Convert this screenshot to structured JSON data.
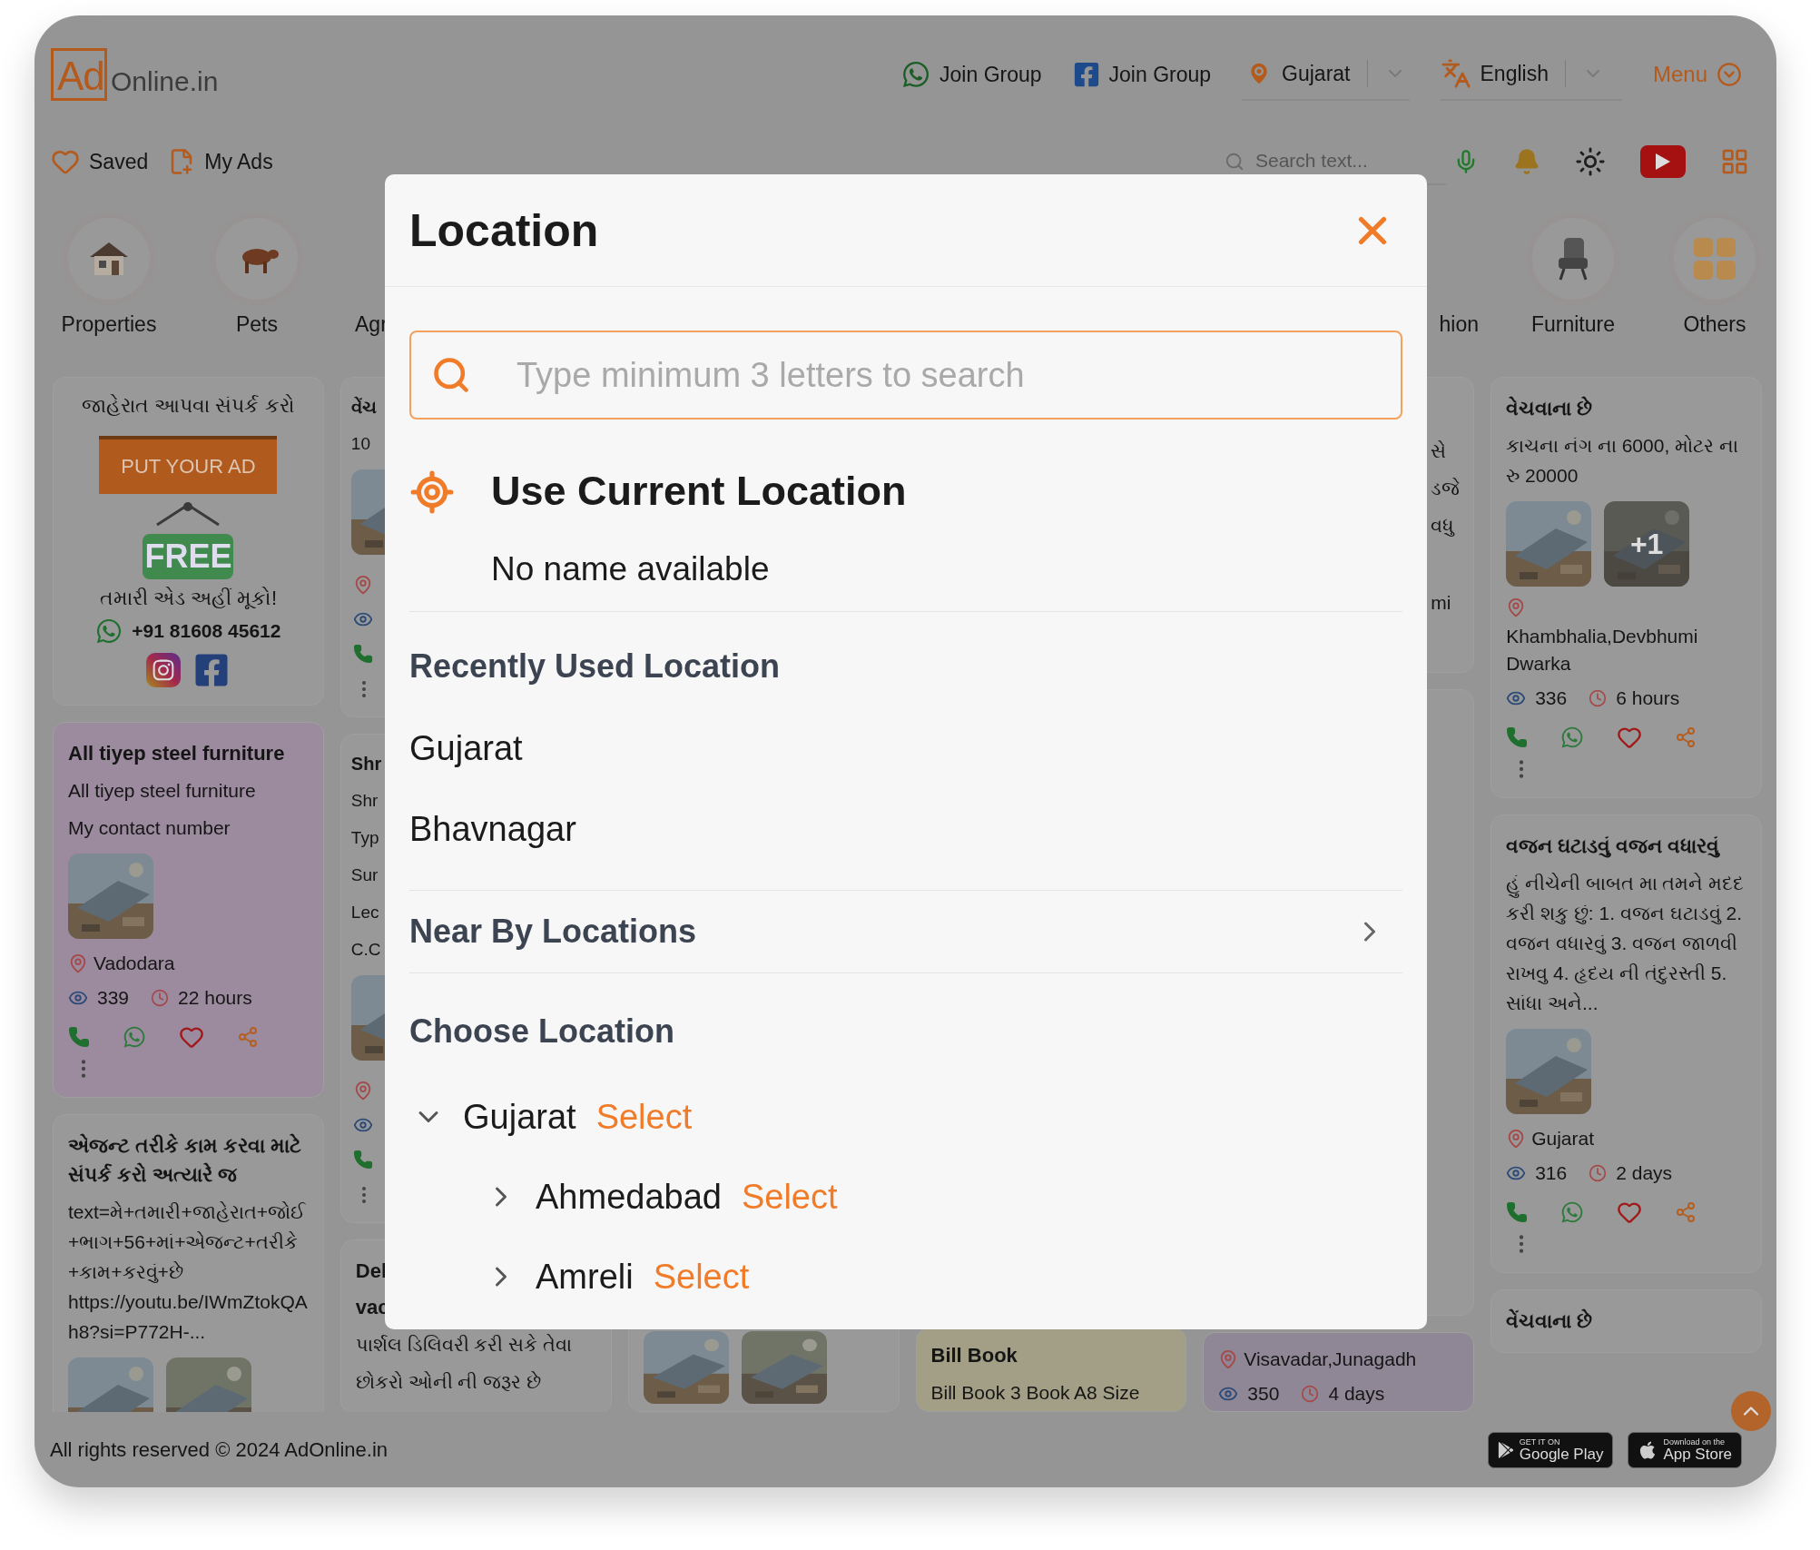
{
  "header": {
    "logo": {
      "mark": "Ad",
      "name": "Online.in"
    },
    "groups": [
      {
        "kind": "whatsapp",
        "label": "Join Group"
      },
      {
        "kind": "facebook",
        "label": "Join Group"
      }
    ],
    "location_select": {
      "value": "Gujarat"
    },
    "language_select": {
      "value": "English"
    },
    "menu": {
      "label": "Menu"
    }
  },
  "toolbar": {
    "links": [
      {
        "kind": "heart",
        "label": "Saved"
      },
      {
        "kind": "notes",
        "label": "My Ads"
      }
    ],
    "search": {
      "placeholder": "Search text..."
    }
  },
  "categories": {
    "start": [
      {
        "kind": "house",
        "label": "Properties"
      },
      {
        "kind": "cow",
        "label": "Pets"
      },
      {
        "kind": "hidden",
        "label": "Agr"
      }
    ],
    "end": [
      {
        "kind": "hidden",
        "label": "hion"
      },
      {
        "kind": "chair",
        "label": "Furniture"
      },
      {
        "kind": "tiles",
        "label": "Others"
      }
    ]
  },
  "columns": [
    {
      "cards": [
        {
          "kind": "promo",
          "heading": "જાહેરાત આપવા સંપર્ક કરો",
          "sign": "PUT YOUR AD",
          "badge": "FREE",
          "caption": "તમારી એડ અહીં મૂકો!",
          "phone": "+91 81608 45612"
        },
        {
          "kind": "ad",
          "color": "#9c8a9e",
          "title": "All tiyep steel furniture",
          "lines": [
            "All tiyep steel furniture",
            "My contact number"
          ],
          "pictures": [
            {
              "kind": "picture"
            }
          ],
          "location": "Vadodara",
          "views": "339",
          "age": "22 hours"
        },
        {
          "kind": "ad",
          "title": "એજન્ટ તરીકે કામ કરવા માટે સંપર્ક કરો અત્યારે જ",
          "lines": [
            "text=મે+તમારી+જાહેરાત+જોઈ+ભાગ+56+માં+એજન્ટ+તરીકે+કામ+કરવું+છે https://youtu.be/IWmZtokQAh8?si=P772H-..."
          ],
          "pictures": [
            {
              "kind": "picture"
            },
            {
              "kind": "picture"
            }
          ]
        }
      ]
    },
    {
      "cards": [
        {
          "kind": "peek",
          "title": "વેંચ",
          "lines": [
            "10"
          ],
          "pictures": [
            {
              "kind": "picture"
            }
          ]
        },
        {
          "kind": "peek",
          "title": "Shr",
          "lines": [
            "Shr",
            "Typ",
            "Sur",
            "Lec",
            "C.C"
          ],
          "pictures": [
            {
              "kind": "picture"
            }
          ]
        },
        {
          "kind": "ad",
          "title": "Del",
          "subtitle": "vac",
          "lines": [
            "પાર્શલ ડિલિવરી કરી સકે તેવા",
            "છોકરો ઓની ની જરૂર છે"
          ]
        }
      ]
    },
    {
      "cards": [
        {
          "kind": "tail",
          "pictures": [
            {
              "kind": "picture"
            },
            {
              "kind": "picture"
            }
          ]
        }
      ]
    },
    {
      "cards": [
        {
          "kind": "tail",
          "color": "#a29f86",
          "title": "Bill Book",
          "lines": [
            "Bill Book 3 Book A8 Size"
          ]
        }
      ]
    },
    {
      "cards": [
        {
          "kind": "peek-right",
          "lines": [
            "સે",
            "ડજે",
            "વધુ"
          ],
          "location": "mi"
        },
        {
          "kind": "blank"
        },
        {
          "kind": "tail",
          "color": "#8f8796",
          "location": "Visavadar,Junagadh",
          "views": "350",
          "age": "4 days"
        }
      ]
    },
    {
      "cards": [
        {
          "kind": "ad",
          "title": "વેચવાના છે",
          "lines": [
            "કાચના નંગ ના 6000, મોટર ના રુ 20000"
          ],
          "pictures": [
            {
              "kind": "picture"
            },
            {
              "kind": "picture",
              "more": "+1"
            }
          ],
          "location": "Khambhalia,Devbhumi Dwarka",
          "views": "336",
          "age": "6 hours"
        },
        {
          "kind": "ad",
          "title": "વજન ઘટાડવું વજન વધારવું",
          "lines": [
            "હું નીચેની બાબત મા તમને મદદ કરી શકુ છું: 1. વજન ઘટાડવું 2. વજન વધારવું 3. વજન જાળવી રાખવુ 4. હૃદય ની તંદુરસ્તી 5. સાંધા અને..."
          ],
          "pictures": [
            {
              "kind": "picture"
            }
          ],
          "location": "Gujarat",
          "views": "316",
          "age": "2 days"
        },
        {
          "kind": "ad",
          "title": "વેંચવાના છે"
        }
      ]
    }
  ],
  "footer": {
    "copyright": "All rights reserved © 2024 AdOnline.in",
    "stores": [
      {
        "kind": "google",
        "small": "GET IT ON",
        "label": "Google Play"
      },
      {
        "kind": "apple",
        "small": "Download on the",
        "label": "App Store"
      }
    ]
  },
  "modal": {
    "title": "Location",
    "search": {
      "placeholder": "Type minimum 3 letters to search"
    },
    "current": {
      "label": "Use Current Location",
      "detail": "No name available"
    },
    "recent": {
      "heading": "Recently Used Location",
      "items": [
        "Gujarat",
        "Bhavnagar"
      ]
    },
    "nearby": {
      "label": "Near By Locations"
    },
    "choose": {
      "heading": "Choose Location",
      "tree": [
        {
          "name": "Gujarat",
          "action": "Select",
          "expanded": true,
          "children": [
            {
              "name": "Ahmedabad",
              "action": "Select",
              "expanded": false
            },
            {
              "name": "Amreli",
              "action": "Select",
              "expanded": false
            }
          ]
        }
      ]
    }
  }
}
